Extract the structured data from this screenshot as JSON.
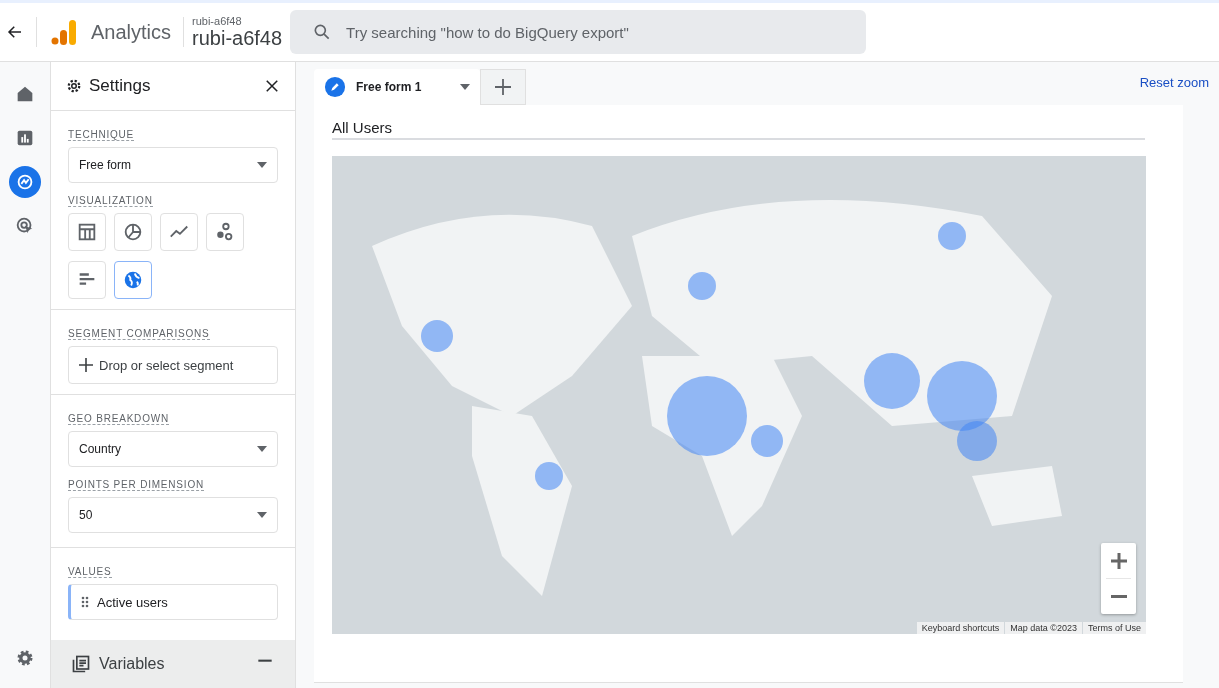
{
  "header": {
    "product": "Analytics",
    "account": "rubi-a6f48",
    "property": "rubi-a6f48",
    "search": {
      "placeholder": "Try searching \"how to do BigQuery export\""
    }
  },
  "nav_rail": [
    {
      "kind": "home",
      "selected": false
    },
    {
      "kind": "reports",
      "selected": false
    },
    {
      "kind": "explore",
      "selected": true
    },
    {
      "kind": "advertising",
      "selected": false
    }
  ],
  "settings": {
    "title": "Settings",
    "technique": {
      "label": "TECHNIQUE",
      "value": "Free form"
    },
    "visualization": {
      "label": "VISUALIZATION",
      "options": [
        {
          "kind": "table",
          "selected": false
        },
        {
          "kind": "donut",
          "selected": false
        },
        {
          "kind": "line",
          "selected": false
        },
        {
          "kind": "scatter",
          "selected": false
        },
        {
          "kind": "bar",
          "selected": false
        },
        {
          "kind": "geo",
          "selected": true
        }
      ]
    },
    "segment_comparisons": {
      "label": "SEGMENT COMPARISONS",
      "placeholder": "Drop or select segment"
    },
    "geo_breakdown": {
      "label": "GEO BREAKDOWN",
      "value": "Country"
    },
    "points_per_dimension": {
      "label": "POINTS PER DIMENSION",
      "value": "50"
    },
    "values": {
      "label": "VALUES",
      "items": [
        "Active users"
      ]
    },
    "variables": {
      "title": "Variables"
    }
  },
  "tabs": [
    {
      "label": "Free form 1",
      "selected": true
    }
  ],
  "reset_zoom": "Reset zoom",
  "map": {
    "title": "All Users",
    "footer": [
      "Keyboard shortcuts",
      "Map data ©2023",
      "Terms of Use"
    ]
  }
}
